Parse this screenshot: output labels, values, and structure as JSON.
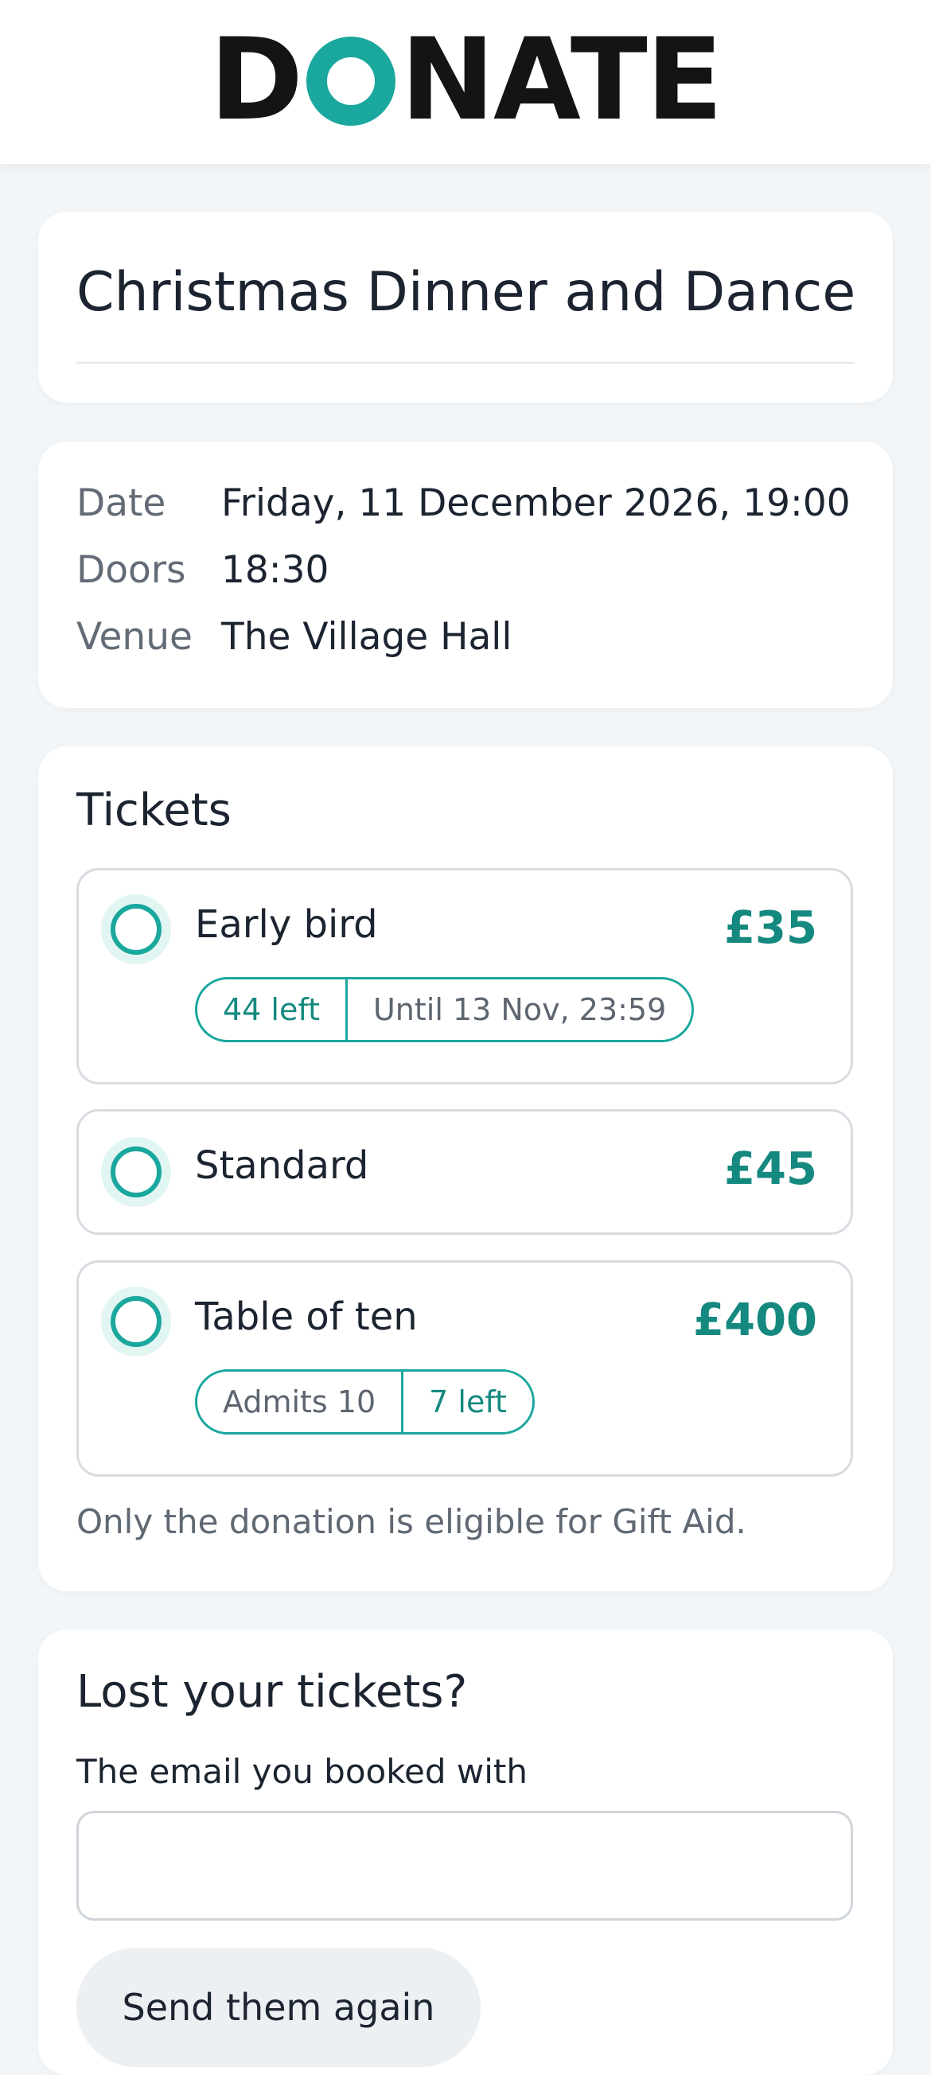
{
  "header": {
    "logo_text_before": "D",
    "logo_text_after": "NATE",
    "logo_full": "DONATE"
  },
  "event": {
    "title": "Christmas Dinner and Dance"
  },
  "info": {
    "rows": [
      {
        "label": "Date",
        "value": "Friday, 11 December 2026, 19:00"
      },
      {
        "label": "Doors",
        "value": "18:30"
      },
      {
        "label": "Venue",
        "value": "The Village Hall"
      }
    ]
  },
  "tickets": {
    "heading": "Tickets",
    "options": [
      {
        "name": "Early bird",
        "price": "£35",
        "tags": [
          "44 left",
          "Until 13 Nov, 23:59"
        ],
        "selected": false
      },
      {
        "name": "Standard",
        "price": "£45",
        "tags": [],
        "selected": false
      },
      {
        "name": "Table of ten",
        "price": "£400",
        "tags": [
          "Admits 10",
          "7 left"
        ],
        "selected": false
      }
    ],
    "gift_aid_note": "Only the donation is eligible for Gift Aid."
  },
  "lost": {
    "heading": "Lost your tickets?",
    "email_label": "The email you booked with",
    "email_value": "",
    "email_placeholder": "",
    "button_label": "Send them again"
  },
  "colors": {
    "accent": "#1aa79e",
    "price": "#15897f",
    "background": "#f3f6f8"
  },
  "icons": {
    "logo_o": "ring-o-icon",
    "radio": "radio-unselected-icon"
  }
}
